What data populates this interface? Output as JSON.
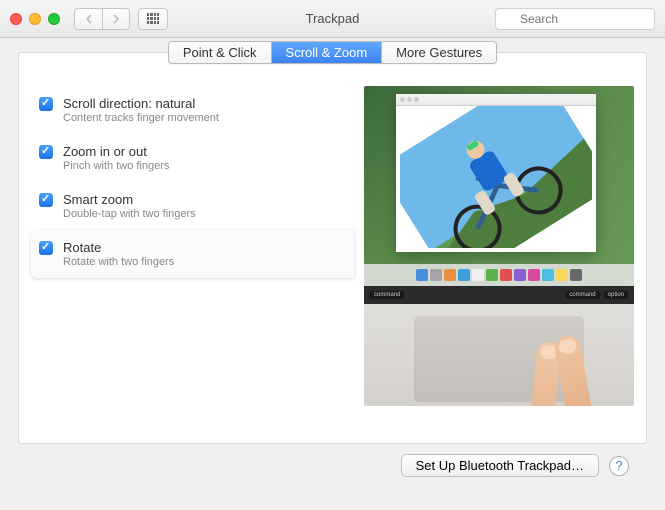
{
  "window": {
    "title": "Trackpad"
  },
  "search": {
    "placeholder": "Search"
  },
  "tabs": [
    {
      "label": "Point & Click",
      "active": false
    },
    {
      "label": "Scroll & Zoom",
      "active": true
    },
    {
      "label": "More Gestures",
      "active": false
    }
  ],
  "options": [
    {
      "title": "Scroll direction: natural",
      "desc": "Content tracks finger movement",
      "checked": true,
      "selected": false
    },
    {
      "title": "Zoom in or out",
      "desc": "Pinch with two fingers",
      "checked": true,
      "selected": false
    },
    {
      "title": "Smart zoom",
      "desc": "Double-tap with two fingers",
      "checked": true,
      "selected": false
    },
    {
      "title": "Rotate",
      "desc": "Rotate with two fingers",
      "checked": true,
      "selected": true
    }
  ],
  "keyboard_labels": {
    "left": "command",
    "right1": "command",
    "right2": "option"
  },
  "footer": {
    "setup_label": "Set Up Bluetooth Trackpad…",
    "help": "?"
  }
}
